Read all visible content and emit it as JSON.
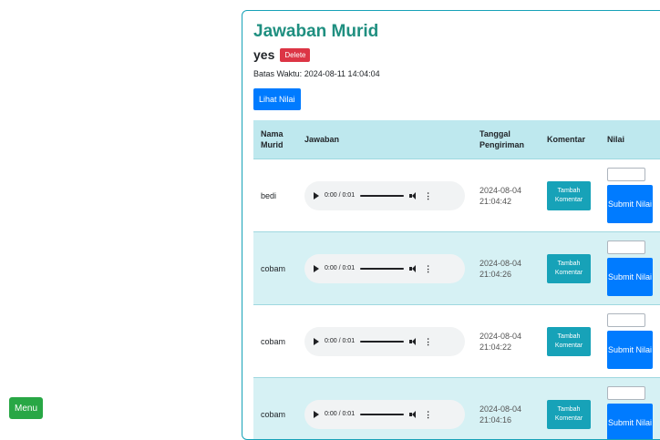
{
  "menu_label": "Menu",
  "card": {
    "title": "Jawaban Murid",
    "subtitle": "yes",
    "delete_label": "Delete",
    "deadline": "Batas Waktu: 2024-08-11 14:04:04",
    "lihat_nilai_label": "Lihat Nilai"
  },
  "table": {
    "headers": {
      "nama_murid": "Nama Murid",
      "jawaban": "Jawaban",
      "tanggal": "Tanggal Pengiriman",
      "komentar": "Komentar",
      "nilai": "Nilai"
    },
    "rows": [
      {
        "name": "bedi",
        "audio_time": "0:00 / 0:01",
        "date": "2024-08-04 21:04:42",
        "komentar_label": "Tambah Komentar",
        "nilai_value": "",
        "submit_label": "Submit Nilai"
      },
      {
        "name": "cobam",
        "audio_time": "0:00 / 0:01",
        "date": "2024-08-04 21:04:26",
        "komentar_label": "Tambah Komentar",
        "nilai_value": "",
        "submit_label": "Submit Nilai"
      },
      {
        "name": "cobam",
        "audio_time": "0:00 / 0:01",
        "date": "2024-08-04 21:04:22",
        "komentar_label": "Tambah Komentar",
        "nilai_value": "",
        "submit_label": "Submit Nilai"
      },
      {
        "name": "cobam",
        "audio_time": "0:00 / 0:01",
        "date": "2024-08-04 21:04:16",
        "komentar_label": "Tambah Komentar",
        "nilai_value": "",
        "submit_label": "Submit Nilai"
      }
    ]
  },
  "icons": {
    "play": "play-icon",
    "volume": "volume-icon",
    "more": "more-vertical-icon"
  },
  "colors": {
    "title": "#1f8f80",
    "primary": "#007bff",
    "info": "#17a2b8",
    "danger": "#dc3545",
    "success": "#28a745",
    "header_bg": "#bee8ee"
  }
}
